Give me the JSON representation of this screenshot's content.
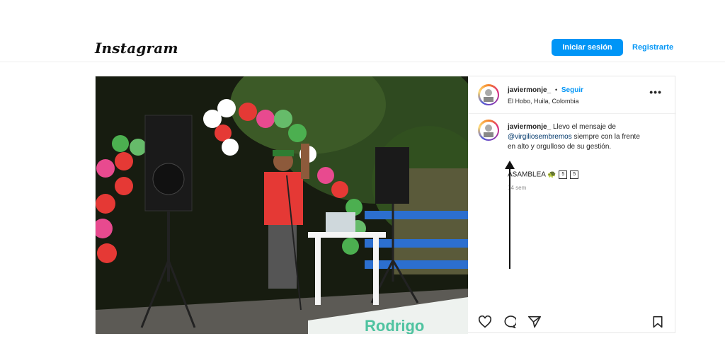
{
  "header": {
    "logo": "Instagram",
    "login_label": "Iniciar sesión",
    "signup_label": "Registrarte"
  },
  "post": {
    "username": "javiermonje_",
    "separator": "•",
    "follow_label": "Seguir",
    "location": "El Hobo, Huila, Colombia",
    "more_label": "•••",
    "caption_before": "Llevo el mensaje de",
    "mention": "@virgiliosembremos",
    "caption_after": "siempre con la frente en alto y orgulloso de su gestión.",
    "asamblea": "ASAMBLEA",
    "boxes": [
      "5",
      "5"
    ],
    "time_ago": "14 sem",
    "banner_text": "Rodrigo",
    "colors": {
      "accent": "#0095f6",
      "mention": "#00376b"
    }
  },
  "icons": [
    "heart-icon",
    "comment-icon",
    "share-icon",
    "bookmark-icon",
    "more-icon"
  ]
}
